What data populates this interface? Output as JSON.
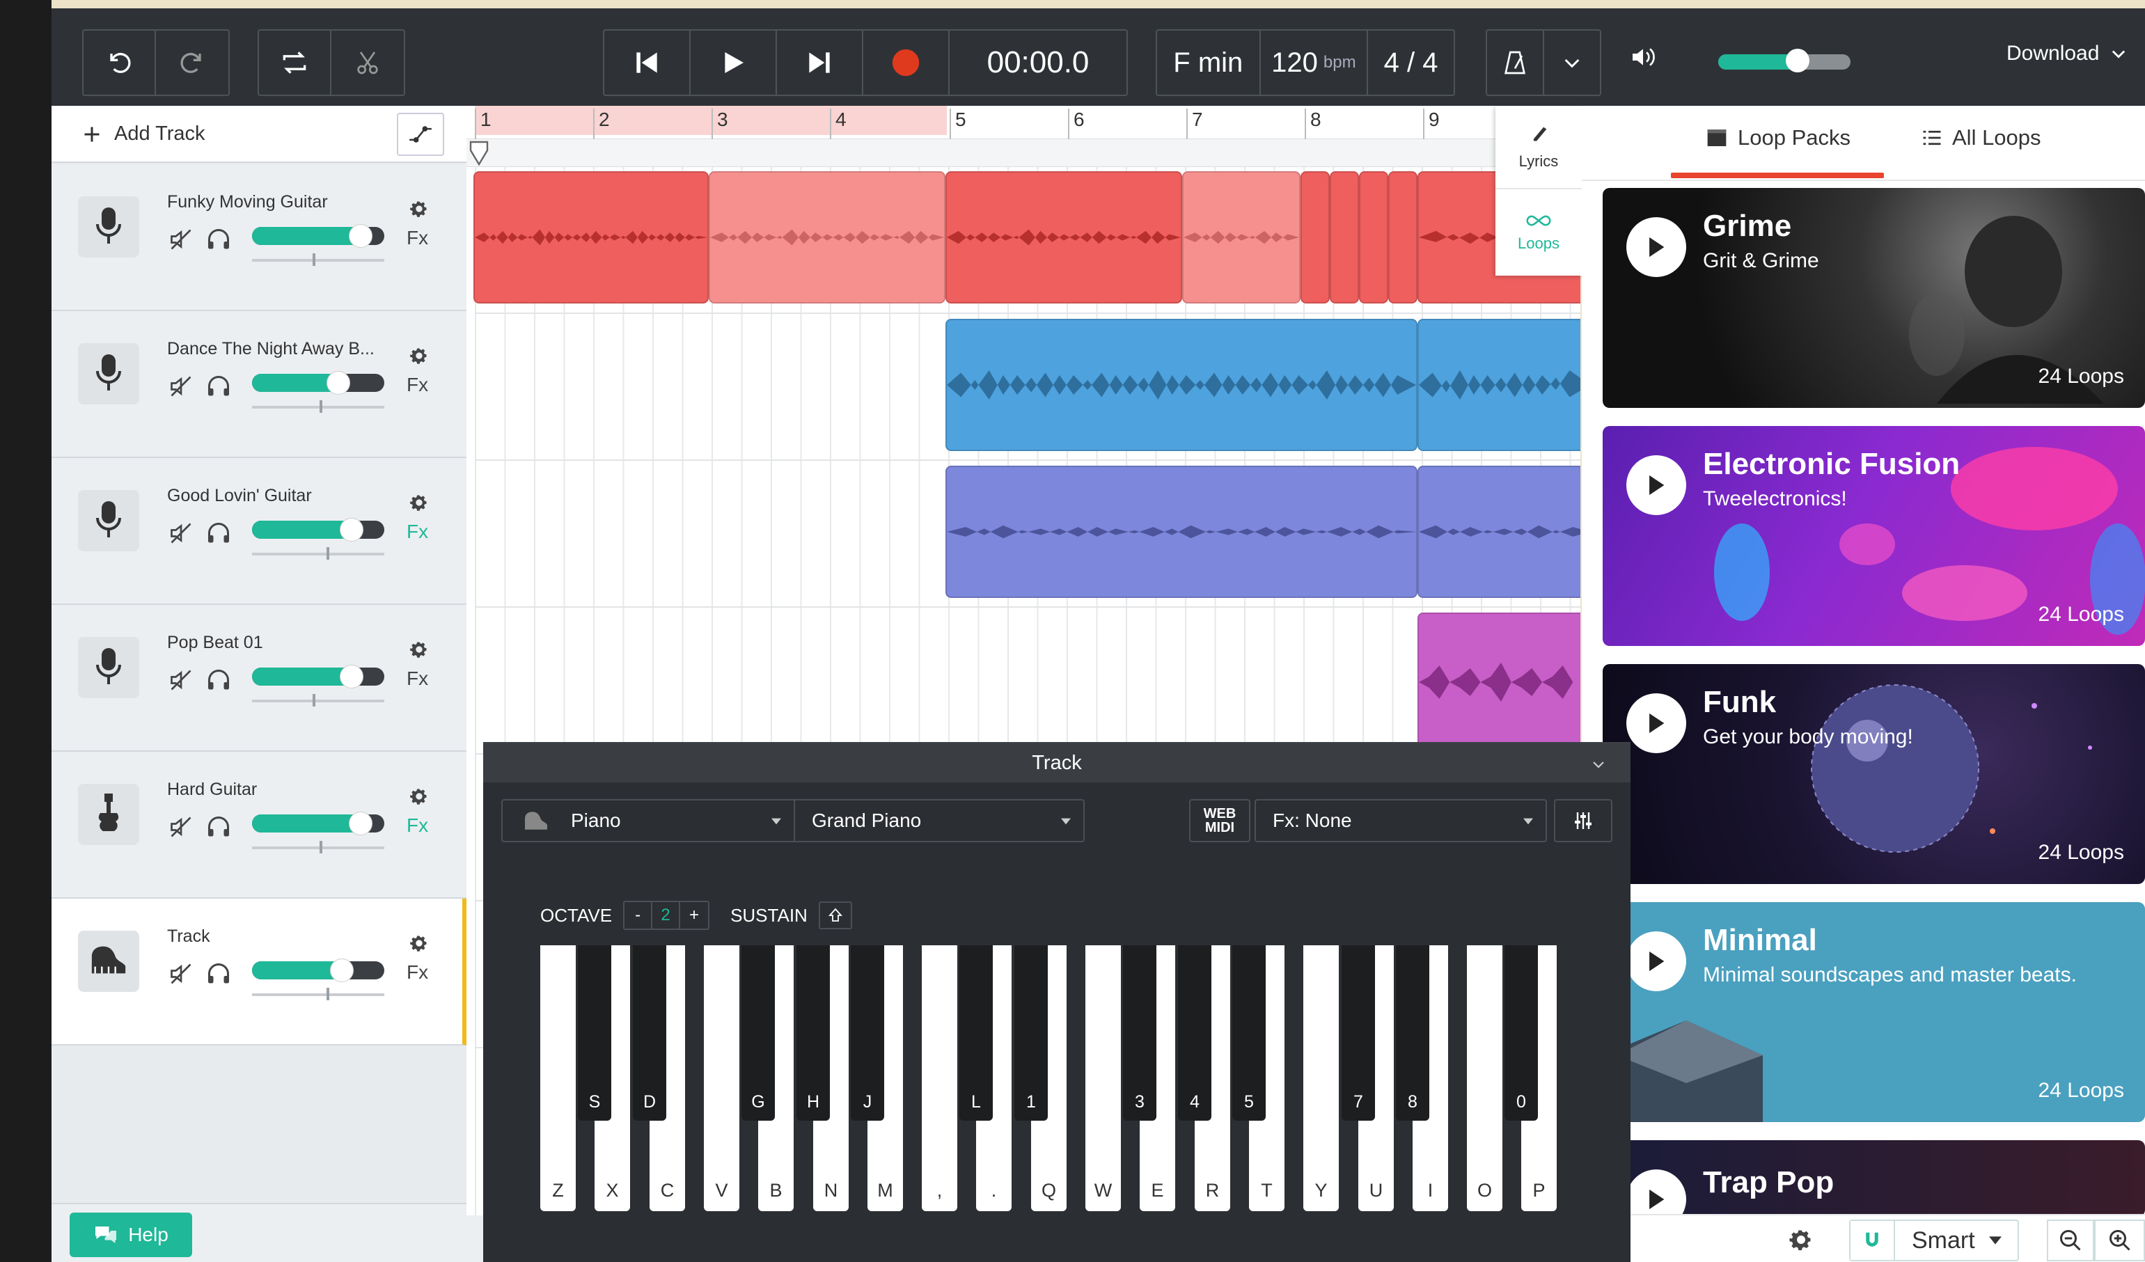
{
  "toolbar": {
    "time": "00:00.0",
    "key": "F min",
    "tempo": "120",
    "tempo_unit": "bpm",
    "time_signature": "4 / 4",
    "volume_level": 0.6,
    "download_label": "Download",
    "accent_color": "#1fb898",
    "record_color": "#e03a1e"
  },
  "tracklist": {
    "add_track_label": "Add Track",
    "tracks": [
      {
        "name": "Funky Moving Guitar",
        "icon": "microphone-icon",
        "volume": 0.82,
        "fx": "Fx",
        "fx_active": false
      },
      {
        "name": "Dance The Night Away B...",
        "icon": "microphone-icon",
        "volume": 0.65,
        "fx": "Fx",
        "fx_active": false
      },
      {
        "name": "Good Lovin' Guitar",
        "icon": "microphone-icon",
        "volume": 0.75,
        "fx": "Fx",
        "fx_active": true
      },
      {
        "name": "Pop Beat 01",
        "icon": "microphone-icon",
        "volume": 0.75,
        "fx": "Fx",
        "fx_active": false
      },
      {
        "name": "Hard Guitar",
        "icon": "guitar-icon",
        "volume": 0.82,
        "fx": "Fx",
        "fx_active": true
      },
      {
        "name": "Track",
        "icon": "piano-icon",
        "volume": 0.68,
        "fx": "Fx",
        "fx_active": false
      }
    ],
    "help_label": "Help"
  },
  "ruler": {
    "bars": [
      "1",
      "2",
      "3",
      "4",
      "5",
      "6",
      "7",
      "8",
      "9"
    ]
  },
  "side_tabs": {
    "lyrics_label": "Lyrics",
    "loops_label": "Loops"
  },
  "loop_panel": {
    "tabs": [
      "Loop Packs",
      "All Loops"
    ],
    "packs": [
      {
        "title": "Grime",
        "subtitle": "Grit & Grime",
        "count": "24 Loops"
      },
      {
        "title": "Electronic Fusion",
        "subtitle": "Tweelectronics!",
        "count": "24 Loops"
      },
      {
        "title": "Funk",
        "subtitle": "Get your body moving!",
        "count": "24 Loops"
      },
      {
        "title": "Minimal",
        "subtitle": "Minimal soundscapes and master beats.",
        "count": "24 Loops"
      },
      {
        "title": "Trap Pop",
        "subtitle": "",
        "count": ""
      }
    ],
    "snap_label": "Smart"
  },
  "keyboard_panel": {
    "title": "Track",
    "instrument": "Piano",
    "preset": "Grand Piano",
    "webmidi_label_1": "WEB",
    "webmidi_label_2": "MIDI",
    "fx_label": "Fx: None",
    "octave_label": "OCTAVE",
    "octave_minus": "-",
    "octave_value": "2",
    "octave_plus": "+",
    "sustain_label": "SUSTAIN",
    "white_keys": [
      "Z",
      "X",
      "C",
      "V",
      "B",
      "N",
      "M",
      ",",
      ".",
      "Q",
      "W",
      "E",
      "R",
      "T",
      "Y",
      "U",
      "I",
      "O",
      "P"
    ],
    "black_keys": [
      "S",
      "D",
      "G",
      "H",
      "J",
      "L",
      "1",
      "3",
      "4",
      "5",
      "7",
      "8",
      "0"
    ]
  }
}
